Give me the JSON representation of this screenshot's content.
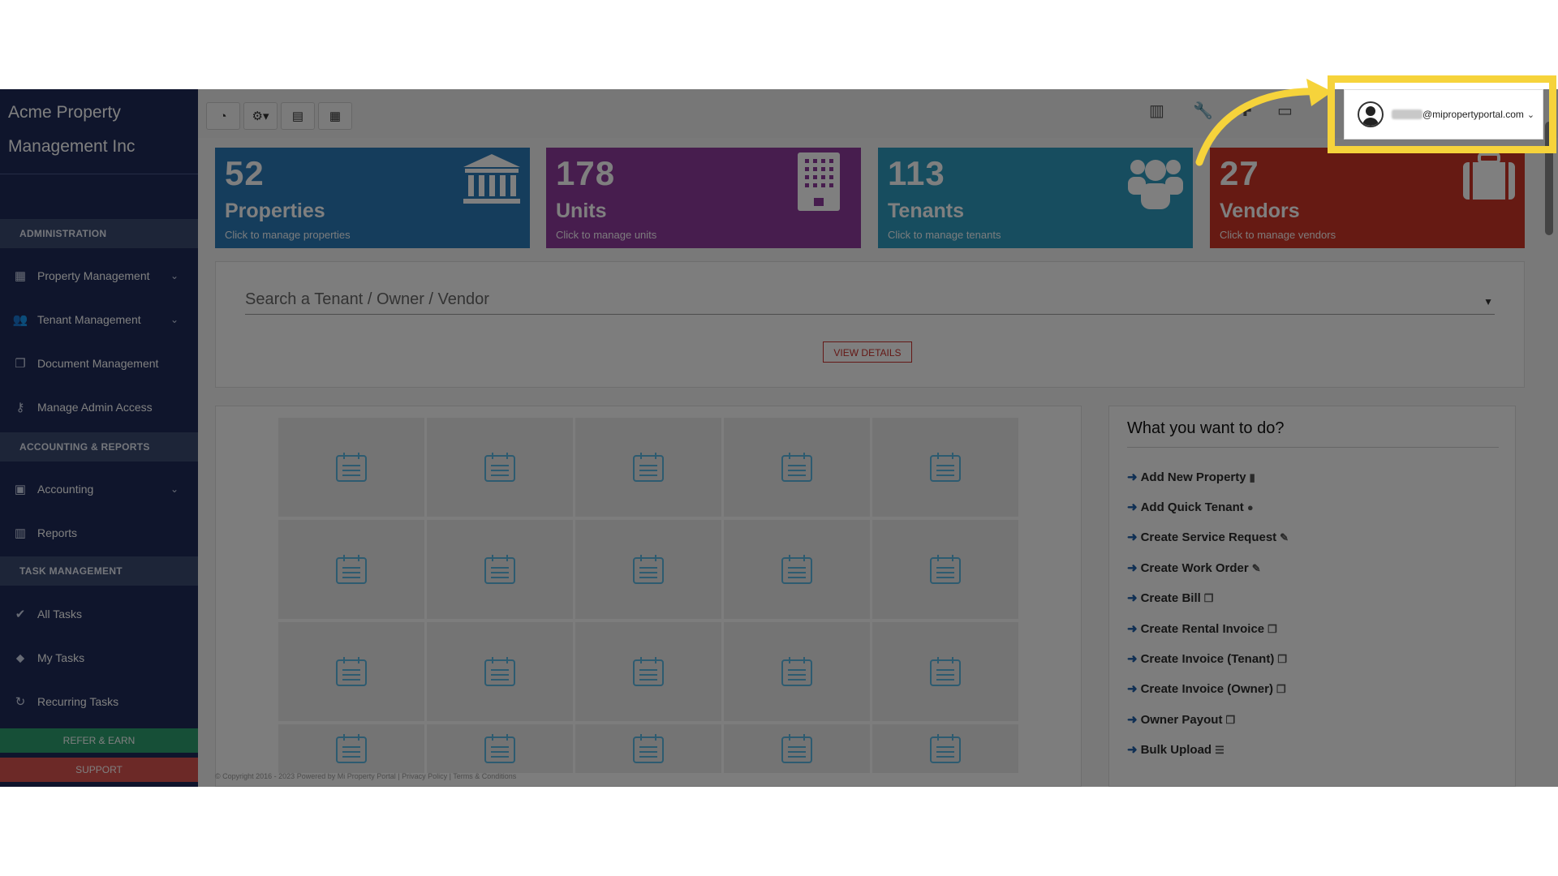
{
  "sidebar": {
    "brand": "Acme Property Management Inc",
    "sections": [
      {
        "title": "ADMINISTRATION"
      },
      {
        "title": "ACCOUNTING & REPORTS"
      },
      {
        "title": "TASK MANAGEMENT"
      }
    ],
    "items": [
      {
        "label": "Property Management",
        "icon": "building-icon",
        "chevron": true
      },
      {
        "label": "Tenant Management",
        "icon": "users-icon",
        "chevron": true
      },
      {
        "label": "Document Management",
        "icon": "documents-icon",
        "chevron": false
      },
      {
        "label": "Manage Admin Access",
        "icon": "key-icon",
        "chevron": false
      },
      {
        "label": "Accounting",
        "icon": "money-icon",
        "chevron": true
      },
      {
        "label": "Reports",
        "icon": "bar-chart-icon",
        "chevron": false
      },
      {
        "label": "All Tasks",
        "icon": "check-icon",
        "chevron": false
      },
      {
        "label": "My Tasks",
        "icon": "tag-icon",
        "chevron": false
      },
      {
        "label": "Recurring Tasks",
        "icon": "refresh-icon",
        "chevron": false
      }
    ],
    "refer": "REFER & EARN",
    "support": "SUPPORT"
  },
  "header": {
    "user_email": "miproperty­portal.com",
    "user_email_visible": "@mipropertyportal.com"
  },
  "cards": [
    {
      "count": "52",
      "title": "Properties",
      "subtitle": "Click to manage properties",
      "color": "#2a7ab8",
      "icon": "bank-icon"
    },
    {
      "count": "178",
      "title": "Units",
      "subtitle": "Click to manage units",
      "color": "#8e3a9d",
      "icon": "apartment-building-icon"
    },
    {
      "count": "113",
      "title": "Tenants",
      "subtitle": "Click to manage tenants",
      "color": "#2f9bbf",
      "icon": "group-icon"
    },
    {
      "count": "27",
      "title": "Vendors",
      "subtitle": "Click to manage vendors",
      "color": "#cc3526",
      "icon": "briefcase-icon"
    }
  ],
  "search": {
    "placeholder": "Search a Tenant / Owner / Vendor",
    "button": "VIEW DETAILS"
  },
  "todo": {
    "title": "What you want to do?",
    "links": [
      "Add New Property",
      "Add Quick Tenant",
      "Create Service Request",
      "Create Work Order",
      "Create Bill",
      "Create Rental Invoice",
      "Create Invoice (Tenant)",
      "Create Invoice (Owner)",
      "Owner Payout",
      "Bulk Upload"
    ]
  },
  "footer": "© Copyright 2016 - 2023 Powered by Mi Property Portal | Privacy Policy | Terms & Conditions"
}
